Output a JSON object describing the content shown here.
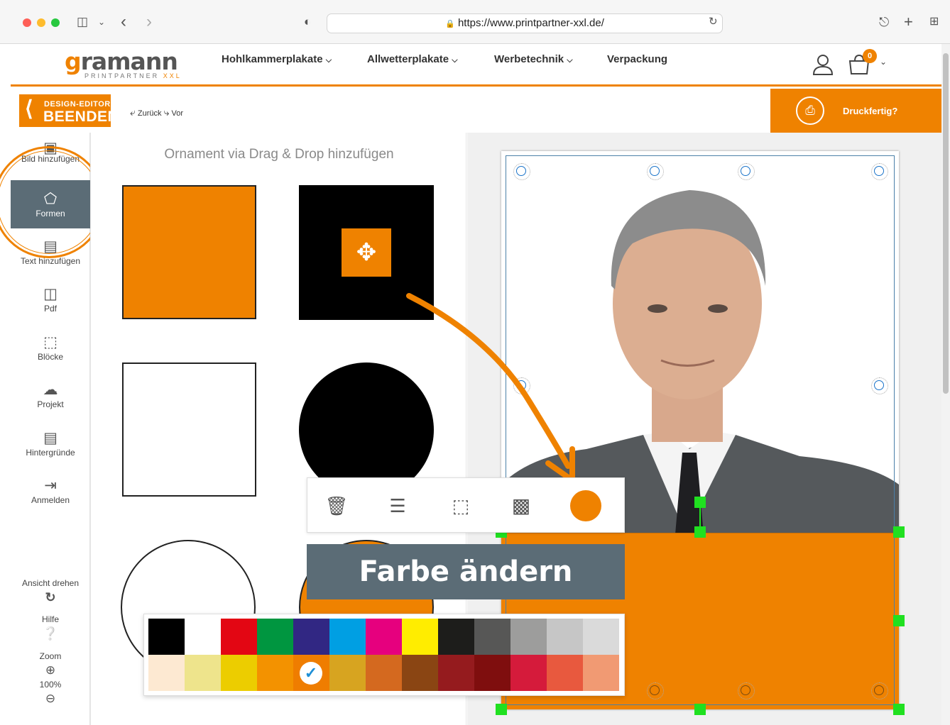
{
  "browser": {
    "url": "https://www.printpartner-xxl.de/"
  },
  "header": {
    "logo_main": "gramann",
    "logo_g": "g",
    "logo_sub": "PRINTPARTNER",
    "logo_sub_xxl": "XXL",
    "nav": [
      "Hohlkammerplakate",
      "Allwetterplakate",
      "Werbetechnik",
      "Verpackung"
    ],
    "cart_count": "0"
  },
  "editor": {
    "exit_line1": "DESIGN-EDITOR",
    "exit_line2": "BEENDEN",
    "undo": "Zurück",
    "redo": "Vor",
    "print_ready": "Druckfertig?"
  },
  "sidebar": {
    "items": [
      "Bild hinzufügen",
      "Formen",
      "Text hinzufügen",
      "Pdf",
      "Blöcke",
      "Projekt",
      "Hintergründe",
      "Anmelden"
    ],
    "rotate_view": "Ansicht drehen",
    "help": "Hilfe",
    "zoom": "Zoom",
    "zoom_level": "100%"
  },
  "panel": {
    "title": "Ornament via Drag & Drop hinzufügen"
  },
  "callout": "Farbe ändern",
  "palette": {
    "selected": "#f39200",
    "row1": [
      "#000000",
      "#ffffff",
      "#e30613",
      "#009640",
      "#312783",
      "#009fe3",
      "#e6007e",
      "#ffed00",
      "#1d1d1b",
      "#575756",
      "#9d9d9c",
      "#c6c6c6",
      "#dadada"
    ],
    "row2": [
      "#fde9d2",
      "#eee48c",
      "#eccd00",
      "#f39200",
      "#ef7d00",
      "#d7a420",
      "#d4691f",
      "#8a4513",
      "#951b1e",
      "#7f0e0e",
      "#d51b3b",
      "#e8593e",
      "#f19a73"
    ]
  },
  "colors": {
    "accent": "#ef8200",
    "sidebar_active": "#5b6c76"
  }
}
